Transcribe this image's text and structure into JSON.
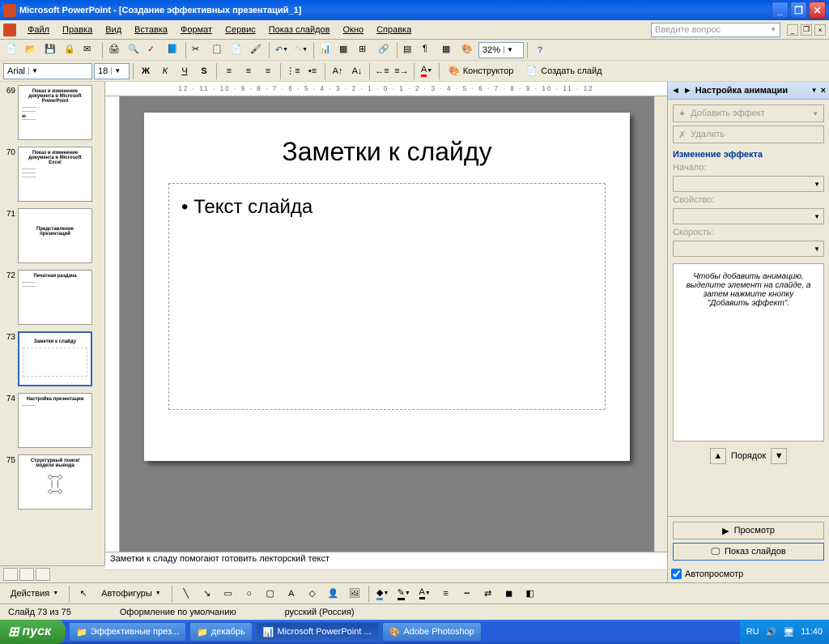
{
  "title": "Microsoft PowerPoint - [Создание эффективных презентаций_1]",
  "menu": {
    "file": "Файл",
    "edit": "Правка",
    "view": "Вид",
    "insert": "Вставка",
    "format": "Формат",
    "tools": "Сервис",
    "slideshow": "Показ слайдов",
    "window": "Окно",
    "help": "Справка"
  },
  "ask_placeholder": "Введите вопрос",
  "toolbar": {
    "font": "Arial",
    "font_size": "18",
    "zoom": "32%",
    "designer": "Конструктор",
    "new_slide": "Создать слайд"
  },
  "ruler": "12 · 11 · 10 · 9 · 8 · 7 · 6 · 5 · 4 · 3 · 2 · 1 · 0 · 1 · 2 · 3 · 4 · 5 · 6 · 7 · 8 · 9 · 10 · 11 · 12",
  "thumbs": [
    {
      "n": 69,
      "title": "Показ и изменение документа в Microsoft PowerPoint"
    },
    {
      "n": 70,
      "title": "Показ и изменение документа в Microsoft Excel"
    },
    {
      "n": 71,
      "title": "Представление презентаций"
    },
    {
      "n": 72,
      "title": "Печатная раздача"
    },
    {
      "n": 73,
      "title": "Заметки к слайду",
      "selected": true
    },
    {
      "n": 74,
      "title": "Настройка презентации"
    },
    {
      "n": 75,
      "title": "Структурный поиск/модели вывода"
    }
  ],
  "slide": {
    "title": "Заметки к слайду",
    "body_bullet": "• Текст слайда"
  },
  "notes": "Заметки к сладу помогают готовить лекторский текст",
  "taskpane": {
    "title": "Настройка анимации",
    "add_effect": "Добавить эффект",
    "remove": "Удалить",
    "change_effect": "Изменение эффекта",
    "start_label": "Начало:",
    "property_label": "Свойство:",
    "speed_label": "Скорость:",
    "hint": "Чтобы добавить анимацию, выделите элемент на слайде, а затем нажмите кнопку \"Добавить эффект\".",
    "order": "Порядок",
    "preview": "Просмотр",
    "slideshow_btn": "Показ слайдов",
    "autopreview": "Автопросмотр"
  },
  "bottom_toolbar": {
    "actions": "Действия",
    "autoshapes": "Автофигуры"
  },
  "status": {
    "slide": "Слайд 73 из 75",
    "template": "Оформление по умолчанию",
    "lang": "русский (Россия)"
  },
  "taskbar": {
    "start": "пуск",
    "items": [
      "Эффективные през...",
      "декабрь",
      "Microsoft PowerPoint ...",
      "Adobe Photoshop"
    ],
    "lang": "RU",
    "time": "11:40"
  }
}
